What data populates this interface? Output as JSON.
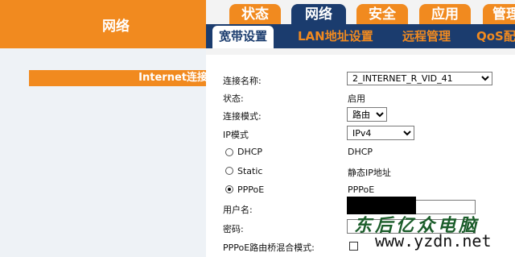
{
  "sidebar": {
    "section_title": "网络",
    "active_item": "Internet连接"
  },
  "tabs": [
    {
      "label": "状态",
      "active": false
    },
    {
      "label": "网络",
      "active": true
    },
    {
      "label": "安全",
      "active": false
    },
    {
      "label": "应用",
      "active": false
    },
    {
      "label": "管理",
      "active": false
    }
  ],
  "subtabs": [
    {
      "label": "宽带设置",
      "active": true
    },
    {
      "label": "LAN地址设置",
      "active": false
    },
    {
      "label": "远程管理",
      "active": false
    },
    {
      "label": "QoS配置",
      "active": false
    }
  ],
  "form": {
    "connection_name_label": "连接名称:",
    "connection_name_value": "2_INTERNET_R_VID_41",
    "status_label": "状态:",
    "status_value": "启用",
    "mode_label": "连接模式:",
    "mode_value": "路由",
    "ip_mode_label": "IP模式",
    "ip_mode_value": "IPv4",
    "options": [
      {
        "label": "DHCP",
        "value": "DHCP",
        "selected": false
      },
      {
        "label": "Static",
        "value": "静态IP地址",
        "selected": true
      },
      {
        "label": "PPPoE",
        "value": "PPPoE",
        "selected": true
      }
    ],
    "username_label": "用户名:",
    "password_label": "密码:",
    "bridge_label": "PPPoE路由桥混合模式:",
    "bridge_checked": false
  },
  "watermark": {
    "text_cn": "东后亿众电脑",
    "url": "www.yzdn.net"
  },
  "colors": {
    "brand_orange": "#f18a1f",
    "nav_blue": "#1b3c6e",
    "panel_gray": "#eef2f6"
  }
}
